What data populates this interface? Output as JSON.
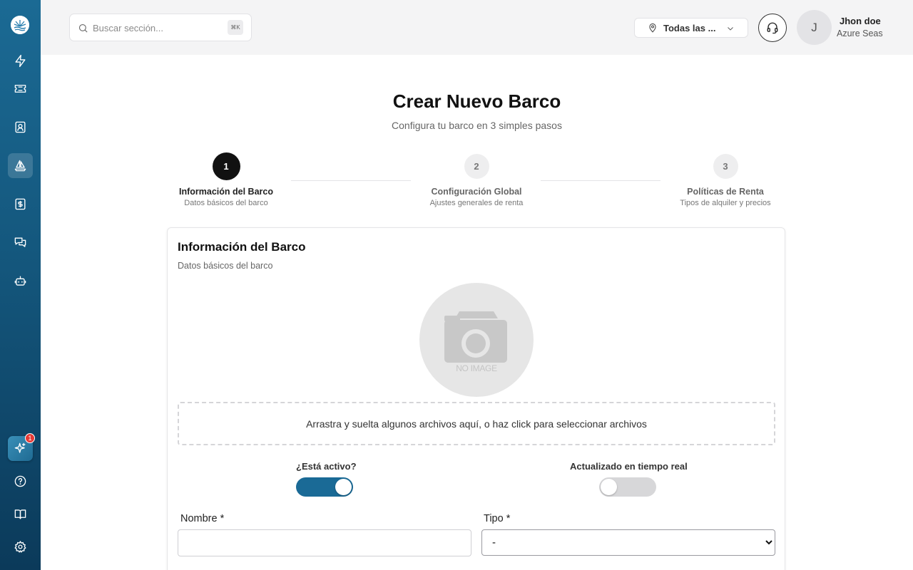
{
  "search": {
    "placeholder": "Buscar sección...",
    "shortcut": "⌘K"
  },
  "location": {
    "label": "Todas las ..."
  },
  "user": {
    "initial": "J",
    "name": "Jhon doe",
    "org": "Azure Seas"
  },
  "sidebar": {
    "items": [
      {
        "icon": "lightning-icon"
      },
      {
        "icon": "ticket-icon"
      },
      {
        "icon": "contact-card-icon"
      },
      {
        "icon": "sailboat-icon",
        "active": true
      },
      {
        "icon": "dollar-receipt-icon"
      },
      {
        "icon": "chat-bubbles-icon"
      },
      {
        "icon": "bot-icon"
      }
    ],
    "ai_badge": "1",
    "bottom": [
      {
        "icon": "help-icon"
      },
      {
        "icon": "book-icon"
      },
      {
        "icon": "gear-icon"
      }
    ]
  },
  "page": {
    "title": "Crear Nuevo Barco",
    "subtitle": "Configura tu barco en 3 simples pasos"
  },
  "steps": [
    {
      "number": "1",
      "title": "Información del Barco",
      "desc": "Datos básicos del barco",
      "active": true
    },
    {
      "number": "2",
      "title": "Configuración Global",
      "desc": "Ajustes generales de renta",
      "active": false
    },
    {
      "number": "3",
      "title": "Políticas de Renta",
      "desc": "Tipos de alquiler y precios",
      "active": false
    }
  ],
  "card": {
    "title": "Información del Barco",
    "subtitle": "Datos básicos del barco",
    "image_placeholder": "NO IMAGE",
    "dropzone": "Arrastra y suelta algunos archivos aquí, o haz click para seleccionar archivos"
  },
  "toggles": {
    "active": {
      "label": "¿Está activo?",
      "on": true
    },
    "realtime": {
      "label": "Actualizado en tiempo real",
      "on": false
    }
  },
  "fields": {
    "name": {
      "label": "Nombre *",
      "value": ""
    },
    "type": {
      "label": "Tipo *",
      "selected": "-"
    }
  },
  "colors": {
    "accent": "#1a6a96",
    "sidebar_top": "#1b6a94",
    "sidebar_bottom": "#0b3a5a"
  }
}
